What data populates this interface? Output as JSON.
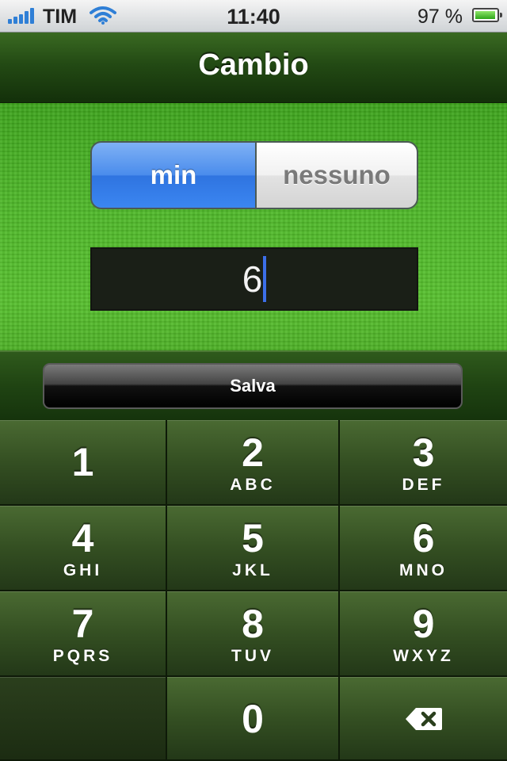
{
  "status_bar": {
    "carrier": "TIM",
    "time": "11:40",
    "battery": "97 %",
    "battery_level": 0.97,
    "icons": [
      "signal-icon",
      "wifi-icon",
      "battery-icon"
    ]
  },
  "nav": {
    "title": "Cambio"
  },
  "segment": {
    "options": [
      "min",
      "nessuno"
    ],
    "selected": "min",
    "selected_color": "#3b86f1"
  },
  "field": {
    "value": "6"
  },
  "toolbar": {
    "save_label": "Salva"
  },
  "keypad": {
    "keys": [
      {
        "num": "1",
        "letters": ""
      },
      {
        "num": "2",
        "letters": "ABC"
      },
      {
        "num": "3",
        "letters": "DEF"
      },
      {
        "num": "4",
        "letters": "GHI"
      },
      {
        "num": "5",
        "letters": "JKL"
      },
      {
        "num": "6",
        "letters": "MNO"
      },
      {
        "num": "7",
        "letters": "PQRS"
      },
      {
        "num": "8",
        "letters": "TUV"
      },
      {
        "num": "9",
        "letters": "WXYZ"
      },
      {
        "num": "0",
        "letters": ""
      }
    ],
    "delete_icon": "backspace-icon"
  }
}
